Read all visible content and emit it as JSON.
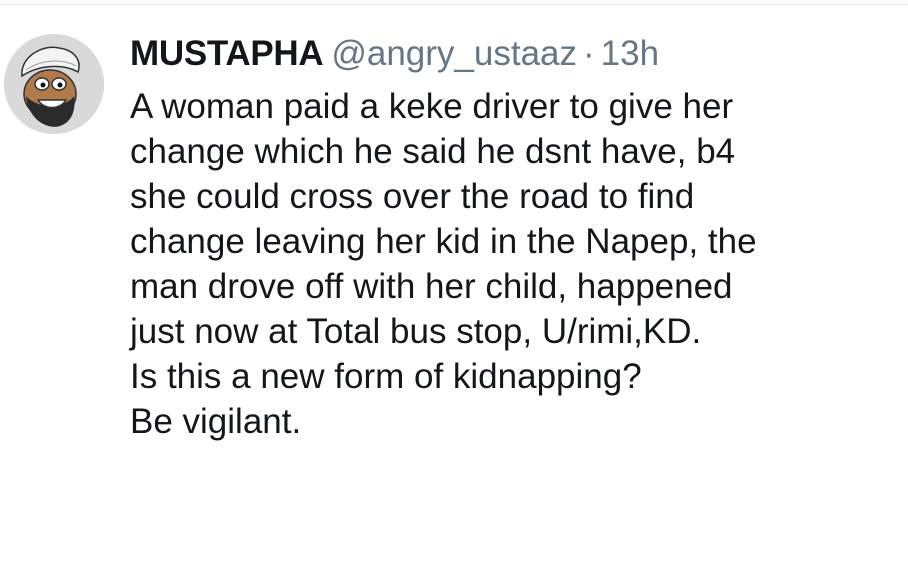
{
  "tweet": {
    "author": {
      "display_name": "MUSTAPHA",
      "handle": "@angry_ustaaz"
    },
    "separator": "·",
    "time": "13h",
    "lines": [
      "A woman paid a keke driver to give her",
      "change which he said he dsnt have, b4",
      "she could cross over the road to find",
      "change leaving her kid in the Napep, the",
      "man drove off with her child, happened",
      "just now at Total bus stop, U/rimi,KD.",
      "Is this a new form of kidnapping?",
      "Be vigilant."
    ]
  },
  "colors": {
    "text": "#14171a",
    "secondary": "#657786",
    "avatar_bg": "#d9d9d9"
  }
}
